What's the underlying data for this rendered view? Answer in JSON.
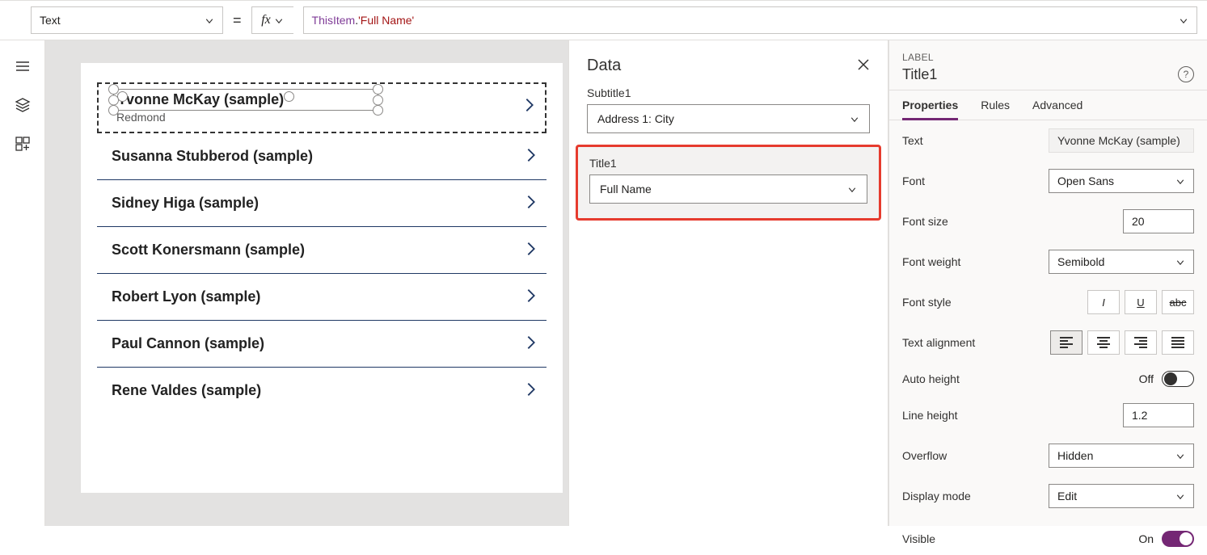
{
  "formula": {
    "property": "Text",
    "fx_label": "fx",
    "expr_prefix": "ThisItem",
    "expr_dot": ".",
    "expr_string": "'Full Name'"
  },
  "gallery": {
    "selected": {
      "title": "Yvonne McKay (sample)",
      "subtitle": "Redmond"
    },
    "items": [
      "Susanna Stubberod (sample)",
      "Sidney Higa (sample)",
      "Scott Konersmann (sample)",
      "Robert Lyon (sample)",
      "Paul Cannon (sample)",
      "Rene Valdes (sample)"
    ]
  },
  "dataPane": {
    "title": "Data",
    "subtitle_label": "Subtitle1",
    "subtitle_value": "Address 1: City",
    "title_label": "Title1",
    "title_value": "Full Name"
  },
  "props": {
    "type": "LABEL",
    "name": "Title1",
    "tabs": {
      "properties": "Properties",
      "rules": "Rules",
      "advanced": "Advanced"
    },
    "text_label": "Text",
    "text_value": "Yvonne McKay (sample)",
    "font_label": "Font",
    "font_value": "Open Sans",
    "fontsize_label": "Font size",
    "fontsize_value": "20",
    "fontweight_label": "Font weight",
    "fontweight_value": "Semibold",
    "fontstyle_label": "Font style",
    "align_label": "Text alignment",
    "autoheight_label": "Auto height",
    "autoheight_value": "Off",
    "lineheight_label": "Line height",
    "lineheight_value": "1.2",
    "overflow_label": "Overflow",
    "overflow_value": "Hidden",
    "displaymode_label": "Display mode",
    "displaymode_value": "Edit",
    "visible_label": "Visible",
    "visible_value": "On"
  }
}
